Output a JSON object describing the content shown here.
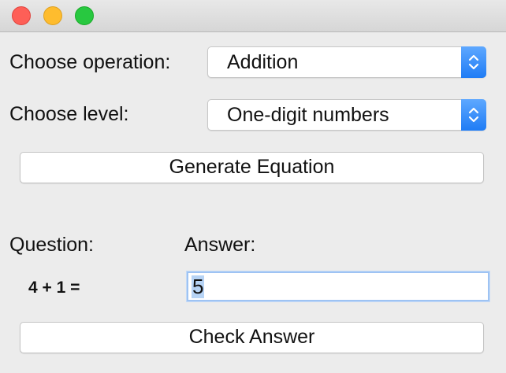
{
  "window": {
    "controls": [
      "close",
      "minimize",
      "zoom"
    ]
  },
  "operation": {
    "label": "Choose operation:",
    "selected": "Addition"
  },
  "level": {
    "label": "Choose level:",
    "selected": "One-digit numbers"
  },
  "generate_button": "Generate Equation",
  "question": {
    "label": "Question:",
    "expression": "4 + 1 ="
  },
  "answer": {
    "label": "Answer:",
    "value": "5"
  },
  "check_button": "Check Answer",
  "colors": {
    "close": "#fe5f57",
    "minimize": "#febc2e",
    "zoom": "#28c840",
    "select_accent": "#1f7cf5",
    "selection_highlight": "#b6d3f5"
  }
}
